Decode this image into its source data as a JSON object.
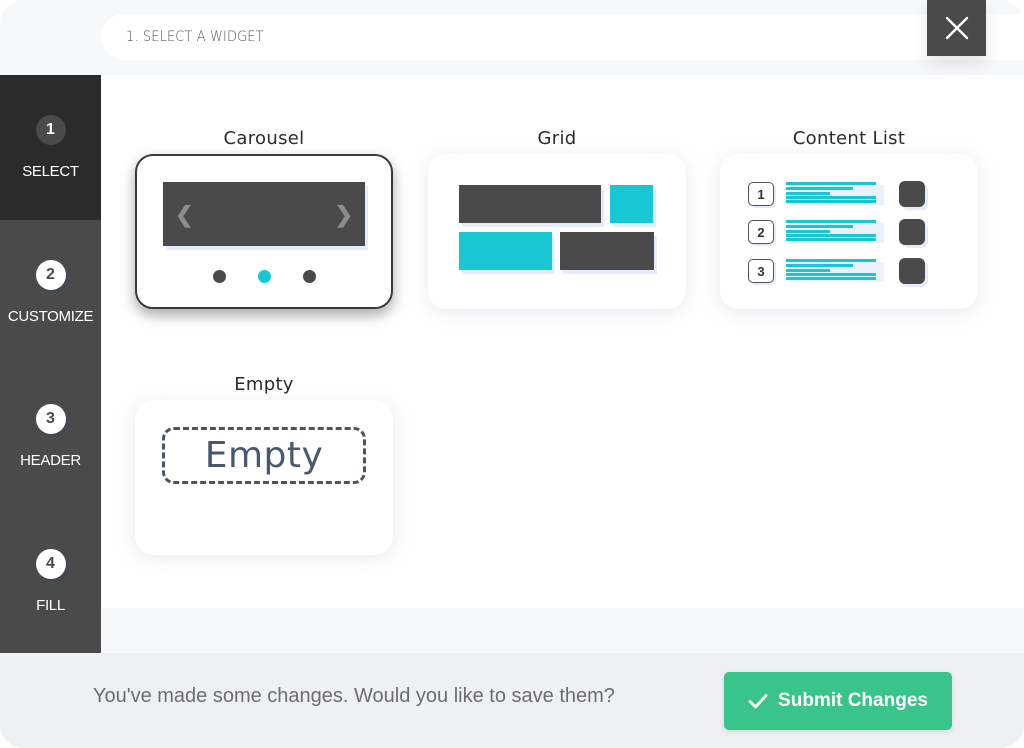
{
  "header": {
    "step_title": "1. SELECT A WIDGET",
    "close_icon": "close-icon"
  },
  "sidebar": {
    "items": [
      {
        "number": "1",
        "label": "SELECT",
        "active": true
      },
      {
        "number": "2",
        "label": "CUSTOMIZE",
        "active": false
      },
      {
        "number": "3",
        "label": "HEADER",
        "active": false
      },
      {
        "number": "4",
        "label": "FILL",
        "active": false
      }
    ]
  },
  "widgets": [
    {
      "title": "Carousel",
      "selected": true,
      "prev_glyph": "❮",
      "next_glyph": "❯",
      "active_dot": 2
    },
    {
      "title": "Grid",
      "selected": false
    },
    {
      "title": "Content List",
      "selected": false,
      "rows": [
        "1",
        "2",
        "3"
      ]
    },
    {
      "title": "Empty",
      "selected": false,
      "placeholder": "Empty"
    }
  ],
  "footer": {
    "message": "You've made some changes. Would you like to save them?",
    "submit_label": "Submit Changes",
    "submit_icon": "check-icon"
  },
  "colors": {
    "accent_cyan": "#17c8d4",
    "submit_green": "#38c48a",
    "dark": "#4a4a4a",
    "sidebar_active": "#2b2b2b"
  }
}
